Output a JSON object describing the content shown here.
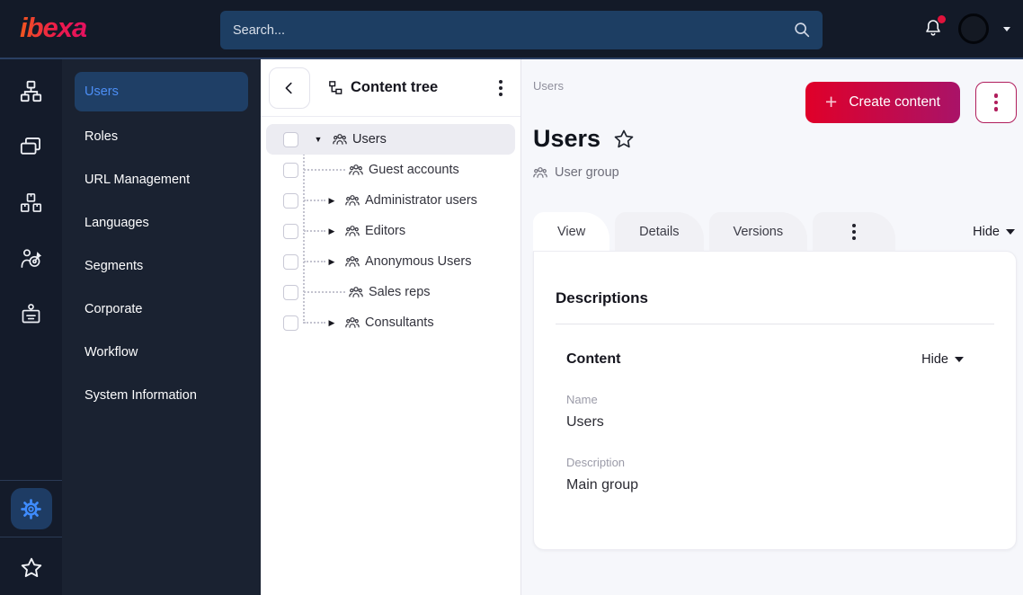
{
  "topbar": {
    "logo": "ibexa",
    "search": {
      "placeholder": "Search..."
    }
  },
  "sidebar": {
    "items": [
      {
        "label": "Users",
        "active": true
      },
      {
        "label": "Roles"
      },
      {
        "label": "URL Management"
      },
      {
        "label": "Languages"
      },
      {
        "label": "Segments"
      },
      {
        "label": "Corporate"
      },
      {
        "label": "Workflow"
      },
      {
        "label": "System Information"
      }
    ]
  },
  "content_tree": {
    "title": "Content tree",
    "items": [
      {
        "label": "Users",
        "state": "expanded",
        "selected": true
      },
      {
        "label": "Guest accounts",
        "state": "leaf"
      },
      {
        "label": "Administrator users",
        "state": "collapsed"
      },
      {
        "label": "Editors",
        "state": "collapsed"
      },
      {
        "label": "Anonymous Users",
        "state": "collapsed"
      },
      {
        "label": "Sales reps",
        "state": "leaf"
      },
      {
        "label": "Consultants",
        "state": "collapsed"
      }
    ]
  },
  "main": {
    "breadcrumb": "Users",
    "create_button_label": "Create content",
    "page_title": "Users",
    "content_type_label": "User group",
    "tabs": [
      {
        "label": "View",
        "active": true
      },
      {
        "label": "Details"
      },
      {
        "label": "Versions"
      }
    ],
    "hide_toggle": "Hide",
    "card": {
      "heading": "Descriptions",
      "section": {
        "heading": "Content",
        "hide_toggle": "Hide",
        "fields": [
          {
            "label": "Name",
            "value": "Users"
          },
          {
            "label": "Description",
            "value": "Main group"
          }
        ]
      }
    }
  },
  "colors": {
    "topbar_bg": "#131a28",
    "search_bg": "#1d3e63",
    "rail_bg": "#141b2a",
    "sidebar_bg": "#1a2231",
    "active_item_bg": "#1f3f66",
    "active_item_text": "#4c8ef5",
    "settings_icon_blue": "#3f8cff",
    "gradient_red": "#e00029",
    "gradient_magenta": "#a91368",
    "kebab_crimson": "#b01d5c",
    "notification_red": "#e0133c",
    "main_bg": "#f6f7fb",
    "tree_selected_bg": "#ececf2"
  }
}
